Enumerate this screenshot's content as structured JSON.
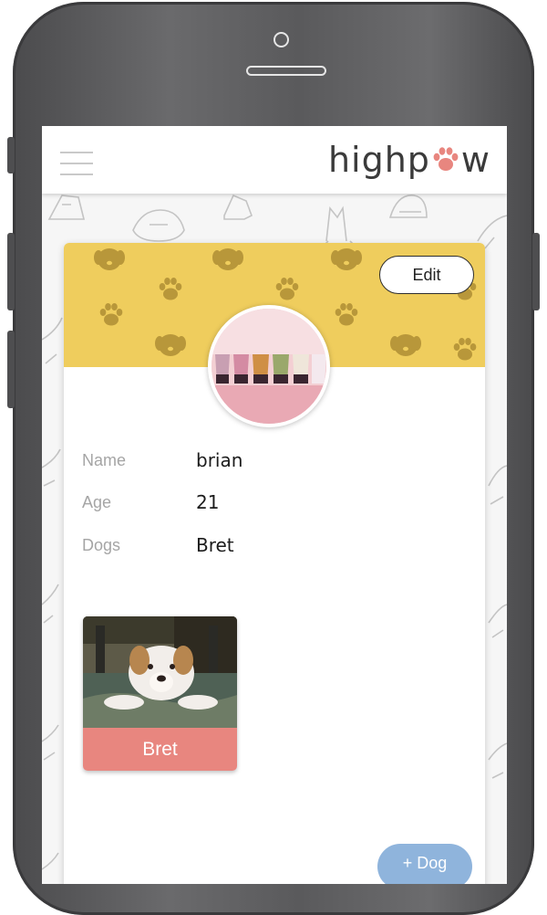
{
  "header": {
    "logo_prefix": "highp",
    "logo_suffix": "w",
    "menu_icon": "hamburger-menu-icon"
  },
  "profile": {
    "edit_label": "Edit",
    "fields": [
      {
        "label": "Name",
        "value": "brian"
      },
      {
        "label": "Age",
        "value": "21"
      },
      {
        "label": "Dogs",
        "value": "Bret"
      }
    ]
  },
  "dogs": [
    {
      "name": "Bret"
    }
  ],
  "actions": {
    "add_dog_label": "+ Dog"
  },
  "colors": {
    "banner": "#efcd5d",
    "banner_pattern": "#b8973a",
    "paw_accent": "#e8867f",
    "dog_label_bg": "#e8867f",
    "add_button": "#8fb4dc"
  }
}
